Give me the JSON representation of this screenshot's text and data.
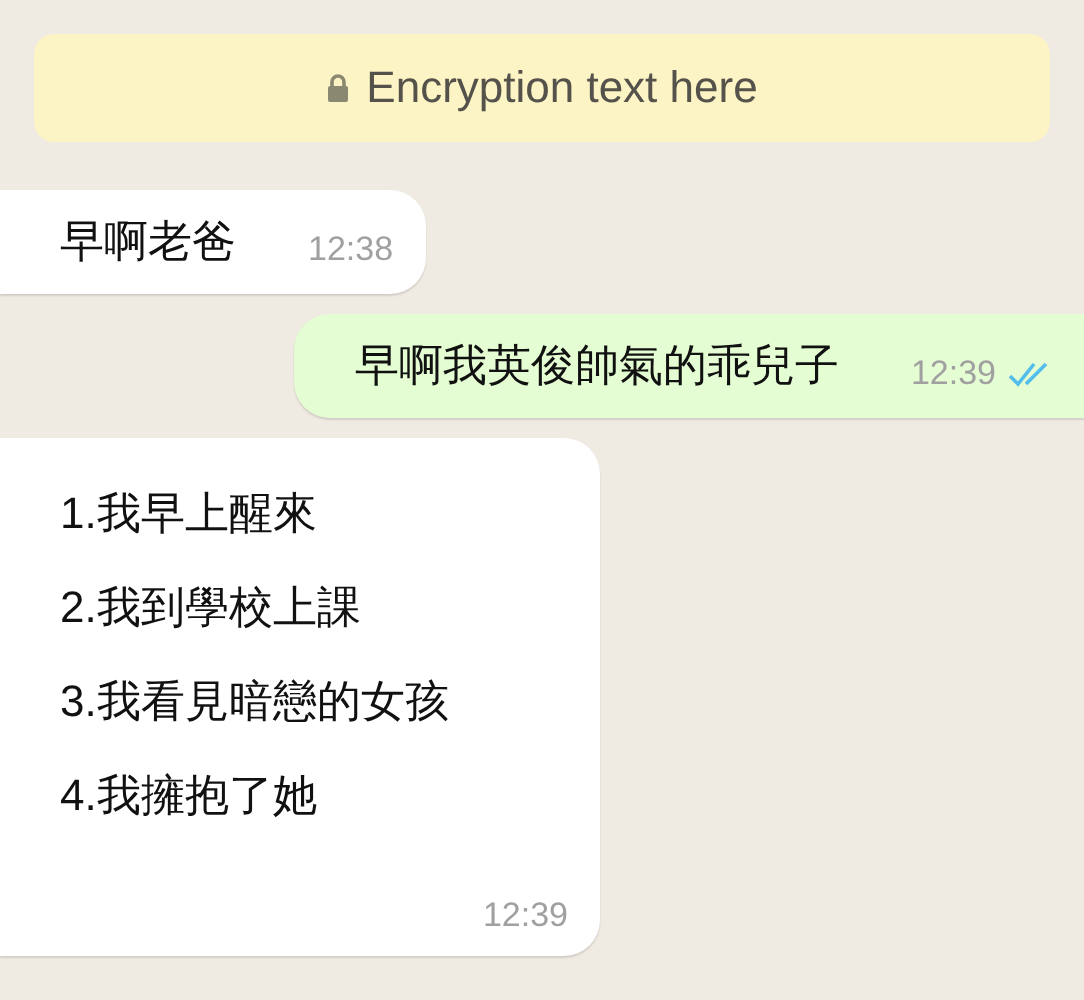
{
  "encryption_notice": {
    "text": "Encryption text here"
  },
  "messages": [
    {
      "kind": "incoming",
      "lines": [
        "早啊老爸"
      ],
      "time": "12:38"
    },
    {
      "kind": "outgoing",
      "lines": [
        "早啊我英俊帥氣的乖兒子"
      ],
      "time": "12:39",
      "read": true
    },
    {
      "kind": "incoming",
      "lines": [
        "1.我早上醒來",
        "2.我到學校上課",
        "3.我看見暗戀的女孩",
        "4.我擁抱了她"
      ],
      "time": "12:39"
    }
  ]
}
